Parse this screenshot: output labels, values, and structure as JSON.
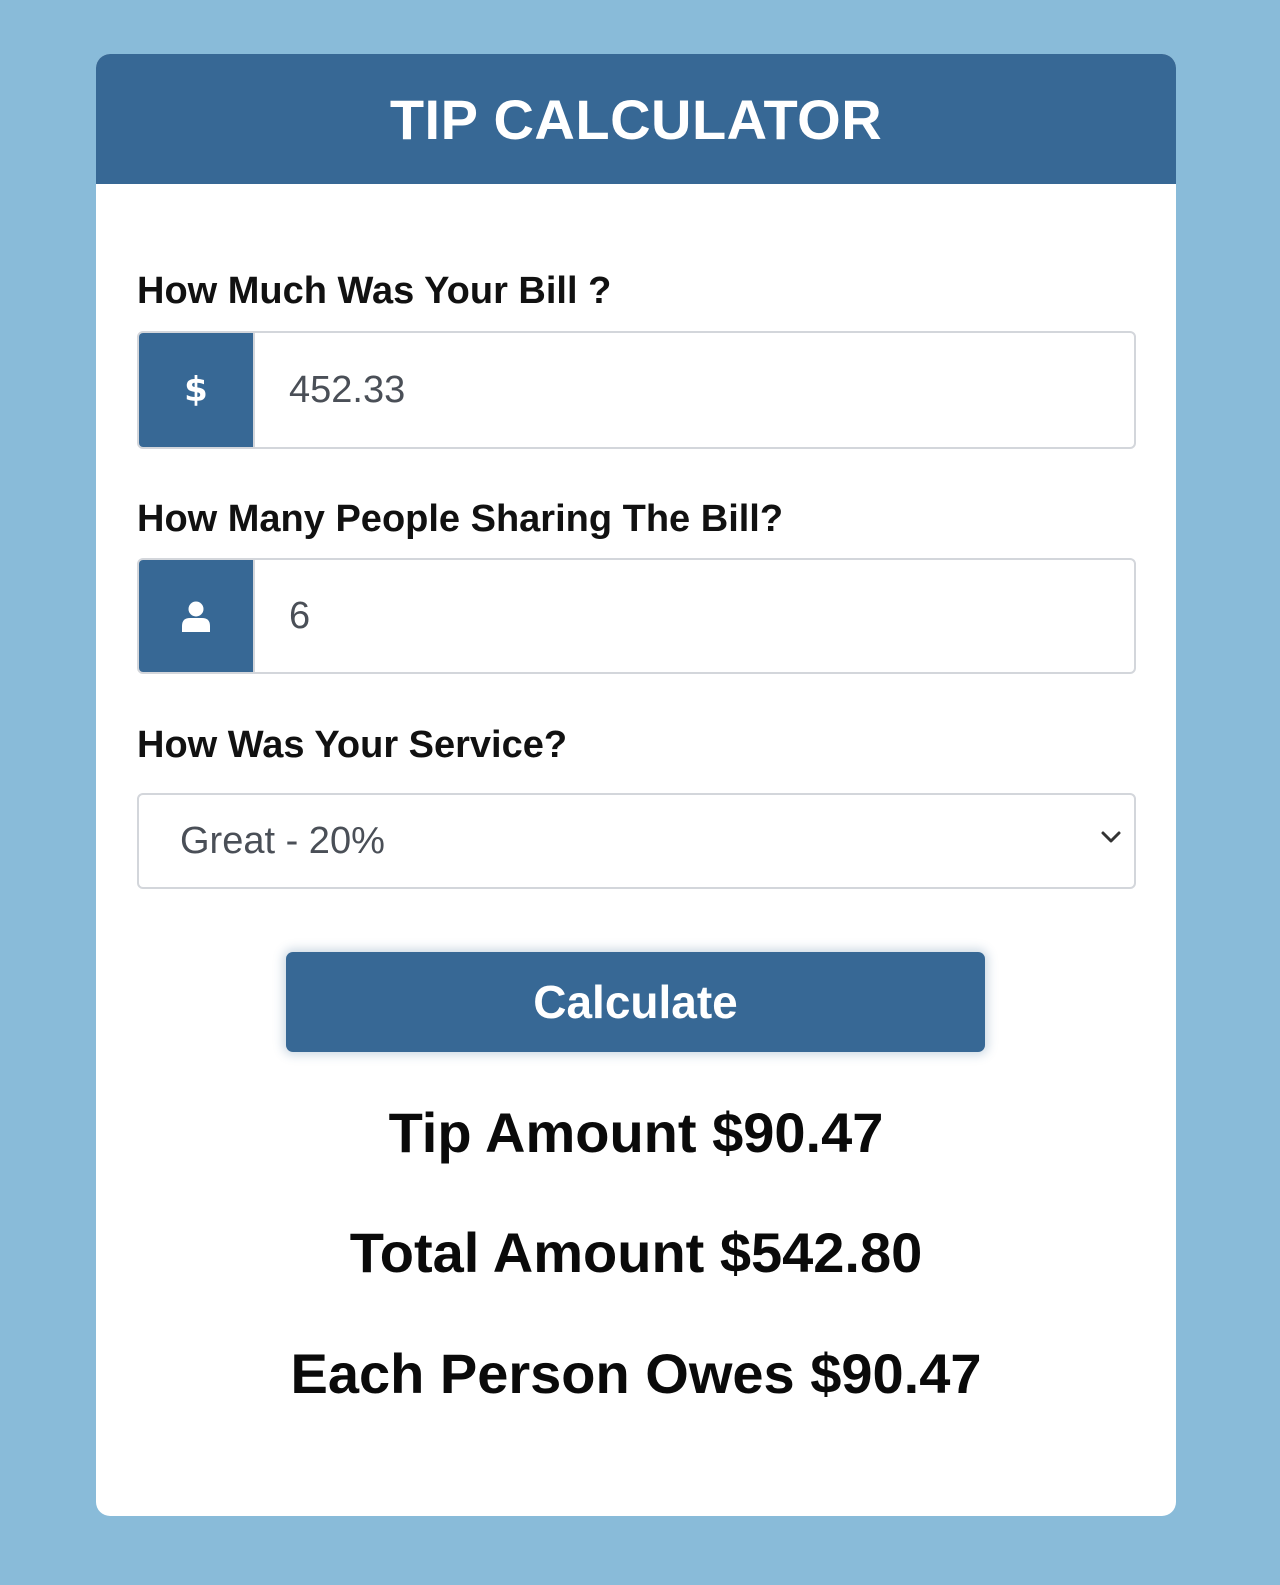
{
  "header": {
    "title": "TIP CALCULATOR"
  },
  "bill": {
    "label": "How Much Was Your Bill ?",
    "addon_symbol": "$",
    "value": "452.33"
  },
  "people": {
    "label": "How Many People Sharing The Bill?",
    "icon": "user-icon",
    "value": "6"
  },
  "service": {
    "label": "How Was Your Service?",
    "selected": "Great - 20%"
  },
  "calculate_button": {
    "label": "Calculate"
  },
  "results": {
    "tip": "Tip Amount $90.47",
    "total": "Total Amount $542.80",
    "each": "Each Person Owes $90.47"
  },
  "colors": {
    "background": "#89bbd9",
    "accent": "#376895",
    "card": "#ffffff"
  }
}
